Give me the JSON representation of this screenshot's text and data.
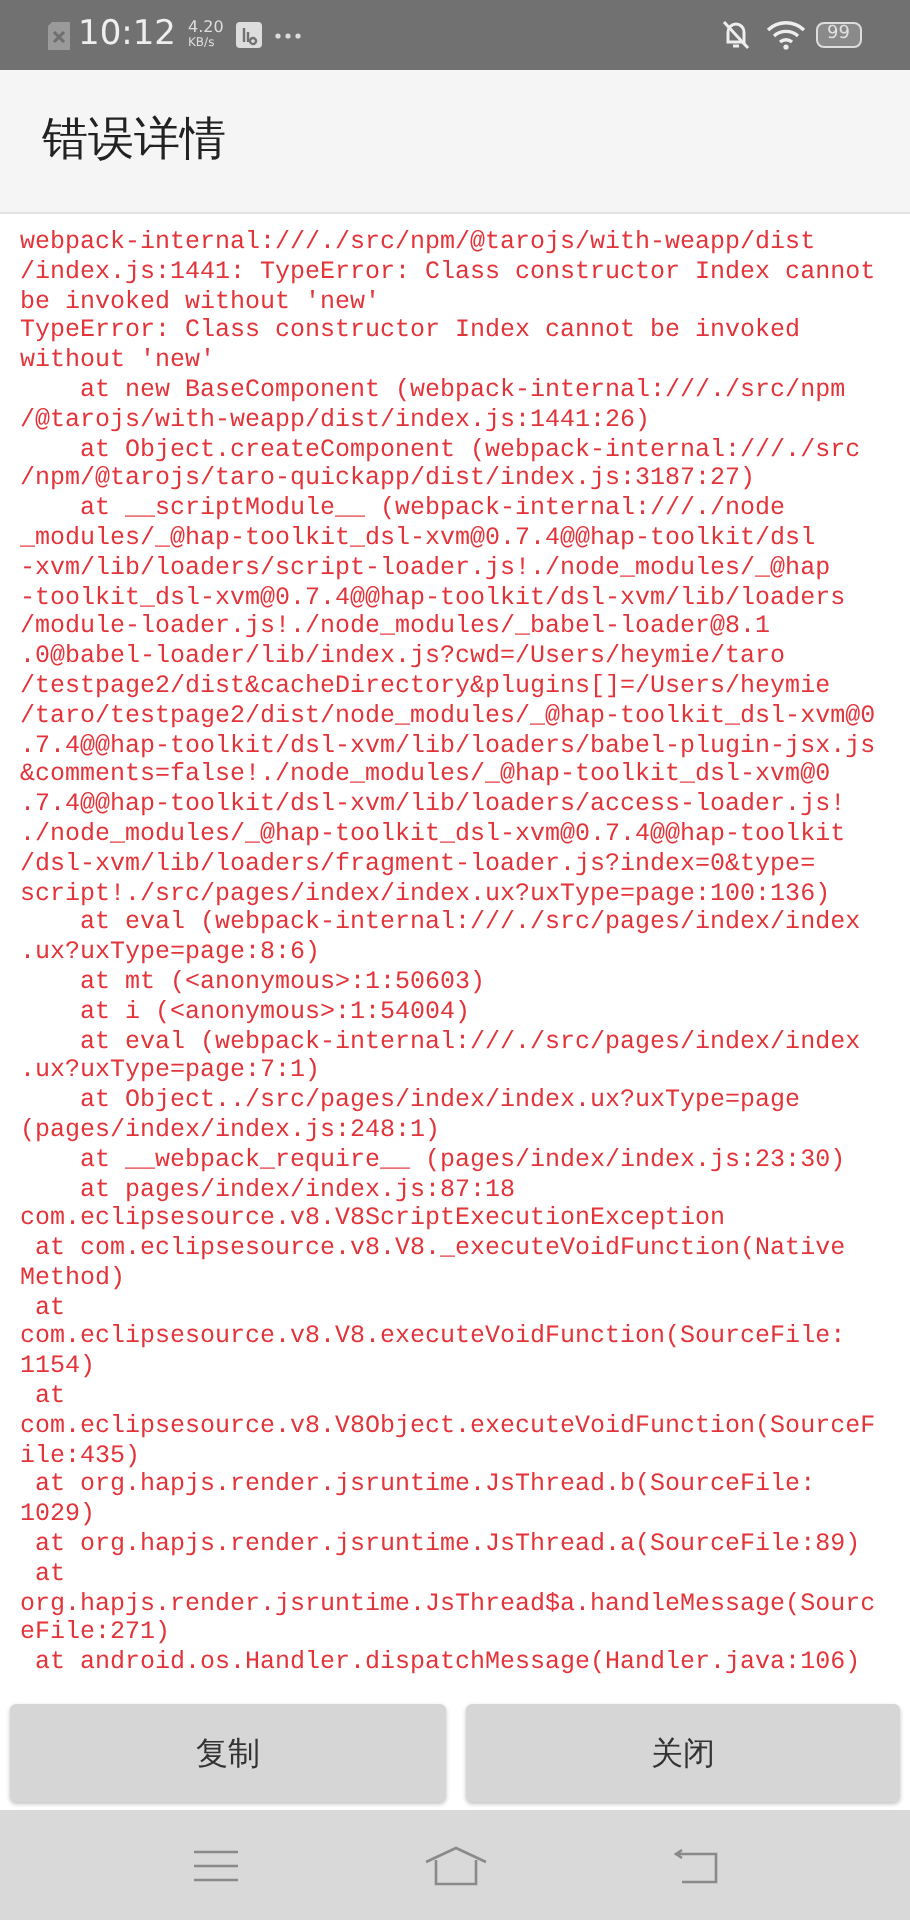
{
  "status_bar": {
    "time": "10:12",
    "speed_value": "4.20",
    "speed_unit": "KB/s",
    "battery": "99"
  },
  "header": {
    "title": "错误详情"
  },
  "error_log": [
    "webpack-internal:///./src/npm/@tarojs/with-weapp/dist",
    "/index.js:1441: TypeError: Class constructor Index cannot",
    "be invoked without 'new'",
    "TypeError: Class constructor Index cannot be invoked",
    "without 'new'",
    "    at new BaseComponent (webpack-internal:///./src/npm",
    "/@tarojs/with-weapp/dist/index.js:1441:26)",
    "    at Object.createComponent (webpack-internal:///./src",
    "/npm/@tarojs/taro-quickapp/dist/index.js:3187:27)",
    "    at __scriptModule__ (webpack-internal:///./node",
    "_modules/_@hap-toolkit_dsl-xvm@0.7.4@@hap-toolkit/dsl",
    "-xvm/lib/loaders/script-loader.js!./node_modules/_@hap",
    "-toolkit_dsl-xvm@0.7.4@@hap-toolkit/dsl-xvm/lib/loaders",
    "/module-loader.js!./node_modules/_babel-loader@8.1",
    ".0@babel-loader/lib/index.js?cwd=/Users/heymie/taro",
    "/testpage2/dist&cacheDirectory&plugins[]=/Users/heymie",
    "/taro/testpage2/dist/node_modules/_@hap-toolkit_dsl-xvm@0",
    ".7.4@@hap-toolkit/dsl-xvm/lib/loaders/babel-plugin-jsx.js",
    "&comments=false!./node_modules/_@hap-toolkit_dsl-xvm@0",
    ".7.4@@hap-toolkit/dsl-xvm/lib/loaders/access-loader.js!",
    "./node_modules/_@hap-toolkit_dsl-xvm@0.7.4@@hap-toolkit",
    "/dsl-xvm/lib/loaders/fragment-loader.js?index=0&type=",
    "script!./src/pages/index/index.ux?uxType=page:100:136)",
    "    at eval (webpack-internal:///./src/pages/index/index",
    ".ux?uxType=page:8:6)",
    "    at mt (<anonymous>:1:50603)",
    "    at i (<anonymous>:1:54004)",
    "    at eval (webpack-internal:///./src/pages/index/index",
    ".ux?uxType=page:7:1)",
    "    at Object../src/pages/index/index.ux?uxType=page",
    "(pages/index/index.js:248:1)",
    "    at __webpack_require__ (pages/index/index.js:23:30)",
    "    at pages/index/index.js:87:18",
    "com.eclipsesource.v8.V8ScriptExecutionException",
    " at com.eclipsesource.v8.V8._executeVoidFunction(Native",
    "Method)",
    " at",
    "com.eclipsesource.v8.V8.executeVoidFunction(SourceFile:",
    "1154)",
    " at",
    "com.eclipsesource.v8.V8Object.executeVoidFunction(SourceF",
    "ile:435)",
    " at org.hapjs.render.jsruntime.JsThread.b(SourceFile:",
    "1029)",
    " at org.hapjs.render.jsruntime.JsThread.a(SourceFile:89)",
    " at",
    "org.hapjs.render.jsruntime.JsThread$a.handleMessage(Sourc",
    "eFile:271)",
    " at android.os.Handler.dispatchMessage(Handler.java:106)"
  ],
  "buttons": [
    {
      "label": "复制"
    },
    {
      "label": "关闭"
    }
  ]
}
